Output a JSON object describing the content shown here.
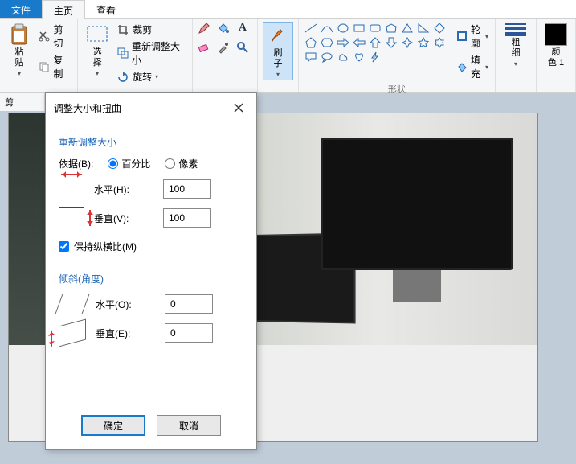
{
  "menu": {
    "file": "文件",
    "home": "主页",
    "view": "查看"
  },
  "ribbon": {
    "clipboard": {
      "paste": "粘\n贴",
      "cut": "剪切",
      "copy": "复制"
    },
    "image": {
      "select": "选\n择",
      "crop": "裁剪",
      "resize": "重新调整大小",
      "rotate": "旋转"
    },
    "tools": {},
    "brushes": {
      "label": "刷\n子"
    },
    "shapes_label": "形状",
    "outline": "轮廓",
    "fill": "填充",
    "stroke": "粗\n细",
    "color1": "颜\n色 1"
  },
  "side_crop_label": "剪",
  "dialog": {
    "title": "调整大小和扭曲",
    "resize_group": "重新调整大小",
    "by_label": "依据(B):",
    "percent": "百分比",
    "pixels": "像素",
    "horizontal_h": "水平(H):",
    "vertical_v": "垂直(V):",
    "h_value": "100",
    "v_value": "100",
    "maintain_aspect": "保持纵横比(M)",
    "skew_group": "倾斜(角度)",
    "horizontal_o": "水平(O):",
    "vertical_e": "垂直(E):",
    "skew_h_value": "0",
    "skew_v_value": "0",
    "ok": "确定",
    "cancel": "取消"
  }
}
